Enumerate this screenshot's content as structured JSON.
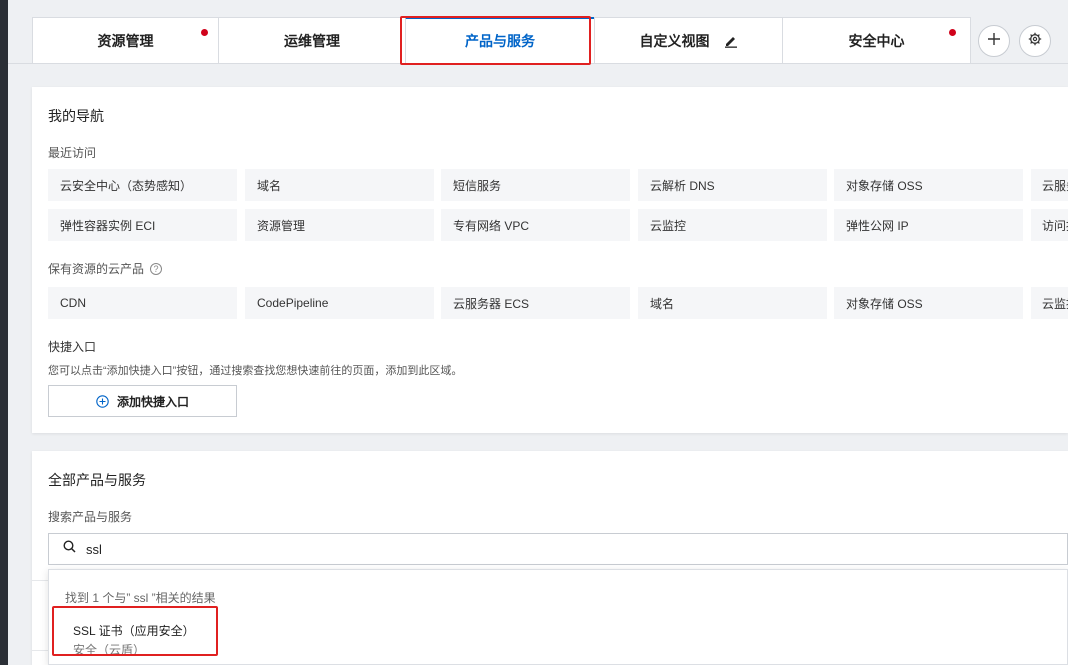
{
  "tabs": [
    {
      "label": "资源管理",
      "dot": true
    },
    {
      "label": "运维管理",
      "dot": false
    },
    {
      "label": "产品与服务",
      "dot": false,
      "active": true
    },
    {
      "label": "自定义视图",
      "dot": false,
      "editable": true
    },
    {
      "label": "安全中心",
      "dot": true
    }
  ],
  "tab_actions": {
    "add_icon": "plus-icon",
    "settings_icon": "gear-icon"
  },
  "nav": {
    "title": "我的导航",
    "recent_label": "最近访问",
    "recent_row1": [
      "云安全中心（态势感知）",
      "域名",
      "短信服务",
      "云解析 DNS",
      "对象存储 OSS",
      "云服务"
    ],
    "recent_row2": [
      "弹性容器实例 ECI",
      "资源管理",
      "专有网络 VPC",
      "云监控",
      "弹性公网 IP",
      "访问控"
    ],
    "owned_label": "保有资源的云产品",
    "owned": [
      "CDN",
      "CodePipeline",
      "云服务器 ECS",
      "域名",
      "对象存储 OSS",
      "云监控"
    ],
    "quick_label": "快捷入口",
    "quick_desc": "您可以点击“添加快捷入口”按钮，通过搜索查找您想快速前往的页面，添加到此区域。",
    "add_button": "添加快捷入口"
  },
  "all_products": {
    "title": "全部产品与服务",
    "search_label": "搜索产品与服务",
    "search_value": "ssl",
    "result_summary": "找到 1 个与” ssl ”相关的结果",
    "results": [
      {
        "name": "SSL 证书（应用安全）",
        "category": "安全（云盾）"
      }
    ]
  },
  "colors": {
    "accent": "#0064c8",
    "alert_dot": "#d0021b",
    "highlight": "#e02020"
  }
}
